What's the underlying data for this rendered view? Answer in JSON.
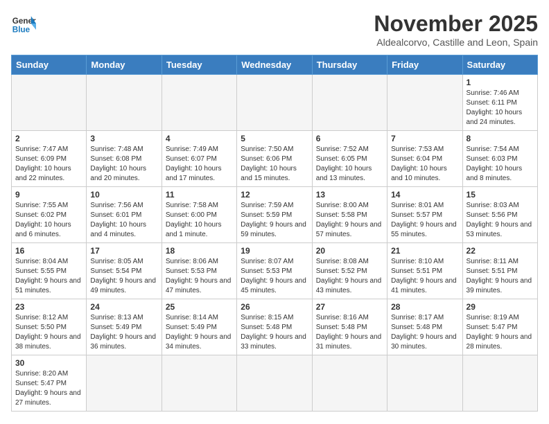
{
  "header": {
    "logo_general": "General",
    "logo_blue": "Blue",
    "title": "November 2025",
    "subtitle": "Aldealcorvo, Castille and Leon, Spain"
  },
  "days_of_week": [
    "Sunday",
    "Monday",
    "Tuesday",
    "Wednesday",
    "Thursday",
    "Friday",
    "Saturday"
  ],
  "weeks": [
    [
      {
        "day": "",
        "info": ""
      },
      {
        "day": "",
        "info": ""
      },
      {
        "day": "",
        "info": ""
      },
      {
        "day": "",
        "info": ""
      },
      {
        "day": "",
        "info": ""
      },
      {
        "day": "",
        "info": ""
      },
      {
        "day": "1",
        "info": "Sunrise: 7:46 AM\nSunset: 6:11 PM\nDaylight: 10 hours and 24 minutes."
      }
    ],
    [
      {
        "day": "2",
        "info": "Sunrise: 7:47 AM\nSunset: 6:09 PM\nDaylight: 10 hours and 22 minutes."
      },
      {
        "day": "3",
        "info": "Sunrise: 7:48 AM\nSunset: 6:08 PM\nDaylight: 10 hours and 20 minutes."
      },
      {
        "day": "4",
        "info": "Sunrise: 7:49 AM\nSunset: 6:07 PM\nDaylight: 10 hours and 17 minutes."
      },
      {
        "day": "5",
        "info": "Sunrise: 7:50 AM\nSunset: 6:06 PM\nDaylight: 10 hours and 15 minutes."
      },
      {
        "day": "6",
        "info": "Sunrise: 7:52 AM\nSunset: 6:05 PM\nDaylight: 10 hours and 13 minutes."
      },
      {
        "day": "7",
        "info": "Sunrise: 7:53 AM\nSunset: 6:04 PM\nDaylight: 10 hours and 10 minutes."
      },
      {
        "day": "8",
        "info": "Sunrise: 7:54 AM\nSunset: 6:03 PM\nDaylight: 10 hours and 8 minutes."
      }
    ],
    [
      {
        "day": "9",
        "info": "Sunrise: 7:55 AM\nSunset: 6:02 PM\nDaylight: 10 hours and 6 minutes."
      },
      {
        "day": "10",
        "info": "Sunrise: 7:56 AM\nSunset: 6:01 PM\nDaylight: 10 hours and 4 minutes."
      },
      {
        "day": "11",
        "info": "Sunrise: 7:58 AM\nSunset: 6:00 PM\nDaylight: 10 hours and 1 minute."
      },
      {
        "day": "12",
        "info": "Sunrise: 7:59 AM\nSunset: 5:59 PM\nDaylight: 9 hours and 59 minutes."
      },
      {
        "day": "13",
        "info": "Sunrise: 8:00 AM\nSunset: 5:58 PM\nDaylight: 9 hours and 57 minutes."
      },
      {
        "day": "14",
        "info": "Sunrise: 8:01 AM\nSunset: 5:57 PM\nDaylight: 9 hours and 55 minutes."
      },
      {
        "day": "15",
        "info": "Sunrise: 8:03 AM\nSunset: 5:56 PM\nDaylight: 9 hours and 53 minutes."
      }
    ],
    [
      {
        "day": "16",
        "info": "Sunrise: 8:04 AM\nSunset: 5:55 PM\nDaylight: 9 hours and 51 minutes."
      },
      {
        "day": "17",
        "info": "Sunrise: 8:05 AM\nSunset: 5:54 PM\nDaylight: 9 hours and 49 minutes."
      },
      {
        "day": "18",
        "info": "Sunrise: 8:06 AM\nSunset: 5:53 PM\nDaylight: 9 hours and 47 minutes."
      },
      {
        "day": "19",
        "info": "Sunrise: 8:07 AM\nSunset: 5:53 PM\nDaylight: 9 hours and 45 minutes."
      },
      {
        "day": "20",
        "info": "Sunrise: 8:08 AM\nSunset: 5:52 PM\nDaylight: 9 hours and 43 minutes."
      },
      {
        "day": "21",
        "info": "Sunrise: 8:10 AM\nSunset: 5:51 PM\nDaylight: 9 hours and 41 minutes."
      },
      {
        "day": "22",
        "info": "Sunrise: 8:11 AM\nSunset: 5:51 PM\nDaylight: 9 hours and 39 minutes."
      }
    ],
    [
      {
        "day": "23",
        "info": "Sunrise: 8:12 AM\nSunset: 5:50 PM\nDaylight: 9 hours and 38 minutes."
      },
      {
        "day": "24",
        "info": "Sunrise: 8:13 AM\nSunset: 5:49 PM\nDaylight: 9 hours and 36 minutes."
      },
      {
        "day": "25",
        "info": "Sunrise: 8:14 AM\nSunset: 5:49 PM\nDaylight: 9 hours and 34 minutes."
      },
      {
        "day": "26",
        "info": "Sunrise: 8:15 AM\nSunset: 5:48 PM\nDaylight: 9 hours and 33 minutes."
      },
      {
        "day": "27",
        "info": "Sunrise: 8:16 AM\nSunset: 5:48 PM\nDaylight: 9 hours and 31 minutes."
      },
      {
        "day": "28",
        "info": "Sunrise: 8:17 AM\nSunset: 5:48 PM\nDaylight: 9 hours and 30 minutes."
      },
      {
        "day": "29",
        "info": "Sunrise: 8:19 AM\nSunset: 5:47 PM\nDaylight: 9 hours and 28 minutes."
      }
    ],
    [
      {
        "day": "30",
        "info": "Sunrise: 8:20 AM\nSunset: 5:47 PM\nDaylight: 9 hours and 27 minutes."
      },
      {
        "day": "",
        "info": ""
      },
      {
        "day": "",
        "info": ""
      },
      {
        "day": "",
        "info": ""
      },
      {
        "day": "",
        "info": ""
      },
      {
        "day": "",
        "info": ""
      },
      {
        "day": "",
        "info": ""
      }
    ]
  ]
}
